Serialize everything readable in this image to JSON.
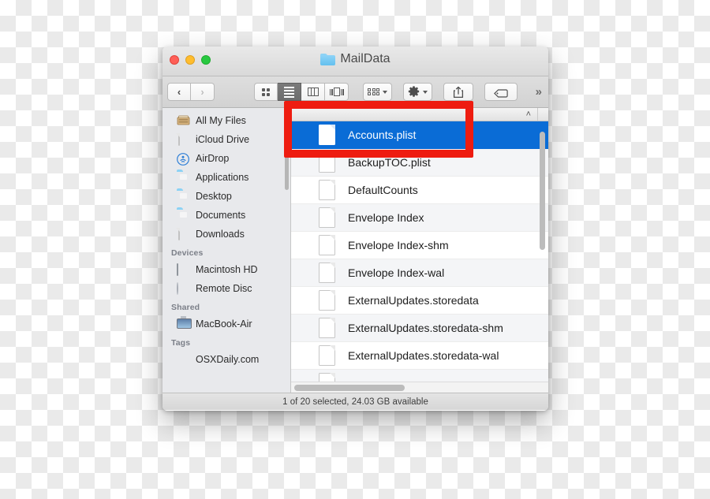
{
  "window": {
    "title": "MailData",
    "title_icon": "folder-icon",
    "traffic_lights": [
      "close-button",
      "minimize-button",
      "maximize-button"
    ]
  },
  "toolbar": {
    "back_glyph": "‹",
    "forward_glyph": "›",
    "view_modes": [
      {
        "name": "icon-view",
        "active": false
      },
      {
        "name": "list-view",
        "active": true
      },
      {
        "name": "column-view",
        "active": false
      },
      {
        "name": "coverflow-view",
        "active": false
      }
    ],
    "arrange_label": "arrange-button",
    "action_label": "action-gear-button",
    "share_label": "share-button",
    "tag_label": "tag-button",
    "overflow_glyph": "»"
  },
  "sidebar": {
    "sections": [
      {
        "header": "",
        "items": [
          {
            "label": "All My Files",
            "icon": "all-my-files-icon"
          },
          {
            "label": "iCloud Drive",
            "icon": "icloud-drive-icon"
          },
          {
            "label": "AirDrop",
            "icon": "airdrop-icon"
          },
          {
            "label": "Applications",
            "icon": "applications-folder-icon"
          },
          {
            "label": "Desktop",
            "icon": "desktop-folder-icon"
          },
          {
            "label": "Documents",
            "icon": "documents-folder-icon"
          },
          {
            "label": "Downloads",
            "icon": "downloads-icon"
          }
        ]
      },
      {
        "header": "Devices",
        "items": [
          {
            "label": "Macintosh HD",
            "icon": "hard-disk-icon"
          },
          {
            "label": "Remote Disc",
            "icon": "optical-disc-icon"
          }
        ]
      },
      {
        "header": "Shared",
        "items": [
          {
            "label": "MacBook-Air",
            "icon": "computer-icon"
          }
        ]
      },
      {
        "header": "Tags",
        "items": [
          {
            "label": "OSXDaily.com",
            "icon": "red-tag-dot-icon"
          }
        ]
      }
    ]
  },
  "filelist": {
    "sort_chevron": "˄",
    "rows": [
      {
        "name": "Accounts.plist",
        "selected": true
      },
      {
        "name": "BackupTOC.plist",
        "selected": false
      },
      {
        "name": "DefaultCounts",
        "selected": false
      },
      {
        "name": "Envelope Index",
        "selected": false
      },
      {
        "name": "Envelope Index-shm",
        "selected": false
      },
      {
        "name": "Envelope Index-wal",
        "selected": false
      },
      {
        "name": "ExternalUpdates.storedata",
        "selected": false
      },
      {
        "name": "ExternalUpdates.storedata-shm",
        "selected": false
      },
      {
        "name": "ExternalUpdates.storedata-wal",
        "selected": false
      }
    ]
  },
  "status": {
    "text": "1 of 20 selected, 24.03 GB available"
  },
  "annotation": {
    "color": "#ee1c10",
    "target": "Accounts.plist"
  },
  "colors": {
    "selection_blue": "#0a6cd6",
    "annotation_red": "#ee1c10",
    "tag_red": "#ff3b30",
    "folder_blue": "#63c0ef"
  }
}
